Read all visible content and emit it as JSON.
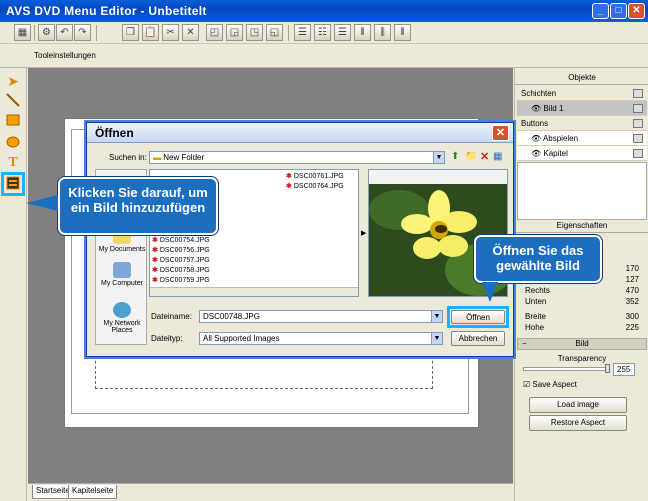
{
  "window": {
    "title": "AVS DVD Menu Editor - Unbetitelt",
    "controls": [
      "_",
      "□",
      "✕"
    ]
  },
  "toolbar": {
    "tool_settings_label": "Tooleinstellungen"
  },
  "left_tools": [
    "arrow-tool",
    "line-tool",
    "rectangle-tool",
    "ellipse-tool",
    "text-tool",
    "image-tool"
  ],
  "canvas_tabs": [
    "Startseite",
    "Kapitelseite"
  ],
  "right_panel": {
    "objects_header": "Objekte",
    "layers_label": "Schichten",
    "layer_item": "Bild 1",
    "buttons_label": "Buttons",
    "button_items": [
      "Abspielen",
      "Kapitel"
    ],
    "properties_header": "Eigenschaften",
    "props": [
      {
        "label": "",
        "value": "170"
      },
      {
        "label": "",
        "value": "127"
      },
      {
        "label": "Rechts",
        "value": "470"
      },
      {
        "label": "Unten",
        "value": "352"
      },
      {
        "label": "Breite",
        "value": "300"
      },
      {
        "label": "Hohe",
        "value": "225"
      }
    ],
    "image_section": "Bild",
    "transparency_label": "Transparency",
    "transparency_value": "255",
    "save_aspect_label": "Save Aspect",
    "load_image_button": "Load image",
    "restore_aspect_button": "Restore Aspect"
  },
  "dialog": {
    "title": "Öffnen",
    "look_in_label": "Suchen in:",
    "look_in_value": "New Folder",
    "places": [
      "My Documents",
      "My Computer",
      "My Network Places"
    ],
    "files_col1": [
      "DSC00754.JPG",
      "DSC00756.JPG",
      "DSC00757.JPG",
      "DSC00758.JPG",
      "DSC00759.JPG"
    ],
    "files_col2": [
      "DSC00761.JPG",
      "DSC00764.JPG"
    ],
    "filename_label": "Dateiname:",
    "filename_value": "DSC00748.JPG",
    "filetype_label": "Dateityp:",
    "filetype_value": "All Supported Images",
    "open_button": "Öffnen",
    "cancel_button": "Abbrechen"
  },
  "callouts": {
    "add_image": "Klicken Sie darauf, um ein Bild hinzuzufügen",
    "open_image": "Öffnen Sie das gewählte Bild"
  },
  "colors": {
    "accent": "#1c6fbf",
    "highlight": "#18b3ff",
    "titlebar": "#0a5fd8"
  }
}
